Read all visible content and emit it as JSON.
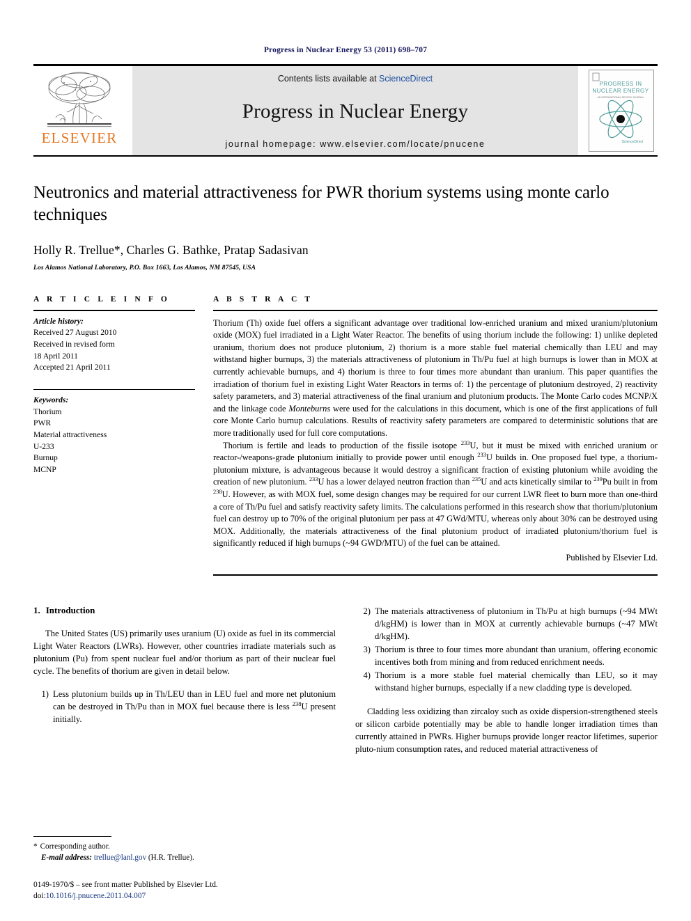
{
  "running_head": "Progress in Nuclear Energy 53 (2011) 698–707",
  "masthead": {
    "publisher_wordmark": "ELSEVIER",
    "contents_prefix": "Contents lists available at ",
    "sciencedirect_link": "ScienceDirect",
    "journal_name": "Progress in Nuclear Energy",
    "homepage_line": "journal homepage: www.elsevier.com/locate/pnucene",
    "cover": {
      "line1": "PROGRESS IN",
      "line2": "NUCLEAR ENERGY",
      "tagline": "AN INTERNATIONAL REVIEW JOURNAL",
      "footer": "ScienceDirect"
    },
    "link_color": "#1c4fa1",
    "elsevier_orange": "#e87722",
    "banner_bg": "#e4e4e4",
    "cover_teal": "#4e9a9a"
  },
  "article": {
    "title": "Neutronics and material attractiveness for PWR thorium systems using monte carlo techniques",
    "authors": "Holly R. Trellue*, Charles G. Bathke, Pratap Sadasivan",
    "affiliation": "Los Alamos National Laboratory, P.O. Box 1663, Los Alamos, NM 87545, USA"
  },
  "article_info": {
    "heading": "A R T I C L E   I N F O",
    "history_label": "Article history:",
    "history_lines": [
      "Received 27 August 2010",
      "Received in revised form",
      "18 April 2011",
      "Accepted 21 April 2011"
    ],
    "keywords_label": "Keywords:",
    "keywords": [
      "Thorium",
      "PWR",
      "Material attractiveness",
      "U-233",
      "Burnup",
      "MCNP"
    ]
  },
  "abstract": {
    "heading": "A B S T R A C T",
    "paragraph1_a": "Thorium (Th) oxide fuel offers a significant advantage over traditional low-enriched uranium and mixed uranium/plutonium oxide (MOX) fuel irradiated in a Light Water Reactor. The benefits of using thorium include the following: 1) unlike depleted uranium, thorium does not produce plutonium, 2) thorium is a more stable fuel material chemically than LEU and may withstand higher burnups, 3) the materials attractiveness of plutonium in Th/Pu fuel at high burnups is lower than in MOX at currently achievable burnups, and 4) thorium is three to four times more abundant than uranium. This paper quantifies the irradiation of thorium fuel in existing Light Water Reactors in terms of: 1) the percentage of plutonium destroyed, 2) reactivity safety parameters, and 3) material attractiveness of the final uranium and plutonium products. The Monte Carlo codes MCNP/X and the linkage code ",
    "paragraph1_italic": "Monteburns",
    "paragraph1_b": " were used for the calculations in this document, which is one of the first applications of full core Monte Carlo burnup calculations. Results of reactivity safety parameters are compared to deterministic solutions that are more traditionally used for full core computations.",
    "paragraph2_a": "Thorium is fertile and leads to production of the fissile isotope ",
    "sup_233_1": "233",
    "paragraph2_b": "U, but it must be mixed with enriched uranium or reactor-/weapons-grade plutonium initially to provide power until enough ",
    "sup_233_2": "233",
    "paragraph2_c": "U builds in. One proposed fuel type, a thorium-plutonium mixture, is advantageous because it would destroy a significant fraction of existing plutonium while avoiding the creation of new plutonium. ",
    "sup_233_3": "233",
    "paragraph2_d": "U has a lower delayed neutron fraction than ",
    "sup_235": "235",
    "paragraph2_e": "U and acts kinetically similar to ",
    "sup_239": "239",
    "paragraph2_f": "Pu built in from ",
    "sup_238": "238",
    "paragraph2_g": "U. However, as with MOX fuel, some design changes may be required for our current LWR fleet to burn more than one-third a core of Th/Pu fuel and satisfy reactivity safety limits. The calculations performed in this research show that thorium/plutonium fuel can destroy up to 70% of the original plutonium per pass at 47 GWd/MTU, whereas only about 30% can be destroyed using MOX. Additionally, the materials attractiveness of the final plutonium product of irradiated plutonium/thorium fuel is significantly reduced if high burnups (~94 GWD/MTU) of the fuel can be attained.",
    "published_by": "Published by Elsevier Ltd."
  },
  "body": {
    "section_number": "1.",
    "section_title": "Introduction",
    "intro_paragraph": "The United States (US) primarily uses uranium (U) oxide as fuel in its commercial Light Water Reactors (LWRs). However, other countries irradiate materials such as plutonium (Pu) from spent nuclear fuel and/or thorium as part of their nuclear fuel cycle. The benefits of thorium are given in detail below.",
    "item1": {
      "marker": "1)",
      "text_a": "Less plutonium builds up in Th/LEU than in LEU fuel and more net plutonium can be destroyed in Th/Pu than in MOX fuel because there is less ",
      "sup": "238",
      "text_b": "U present initially."
    },
    "item2": {
      "marker": "2)",
      "text": "The materials attractiveness of plutonium in Th/Pu at high burnups (~94 MWt d/kgHM) is lower than in MOX at currently achievable burnups (~47 MWt d/kgHM)."
    },
    "item3": {
      "marker": "3)",
      "text": "Thorium is three to four times more abundant than uranium, offering economic incentives both from mining and from reduced enrichment needs."
    },
    "item4": {
      "marker": "4)",
      "text": "Thorium is a more stable fuel material chemically than LEU, so it may withstand higher burnups, especially if a new cladding type is developed."
    },
    "cladding_paragraph": "Cladding less oxidizing than zircaloy such as oxide dispersion-strengthened steels or silicon carbide potentially may be able to handle longer irradiation times than currently attained in PWRs. Higher burnups provide longer reactor lifetimes, superior pluto-nium consumption rates, and reduced material attractiveness of"
  },
  "footnotes": {
    "star": "*",
    "corresponding": "Corresponding author.",
    "email_label": "E-mail address:",
    "email": "trellue@lanl.gov",
    "email_suffix": "(H.R. Trellue).",
    "issn_line": "0149-1970/$ – see front matter Published by Elsevier Ltd.",
    "doi_prefix": "doi:",
    "doi": "10.1016/j.pnucene.2011.04.007"
  }
}
